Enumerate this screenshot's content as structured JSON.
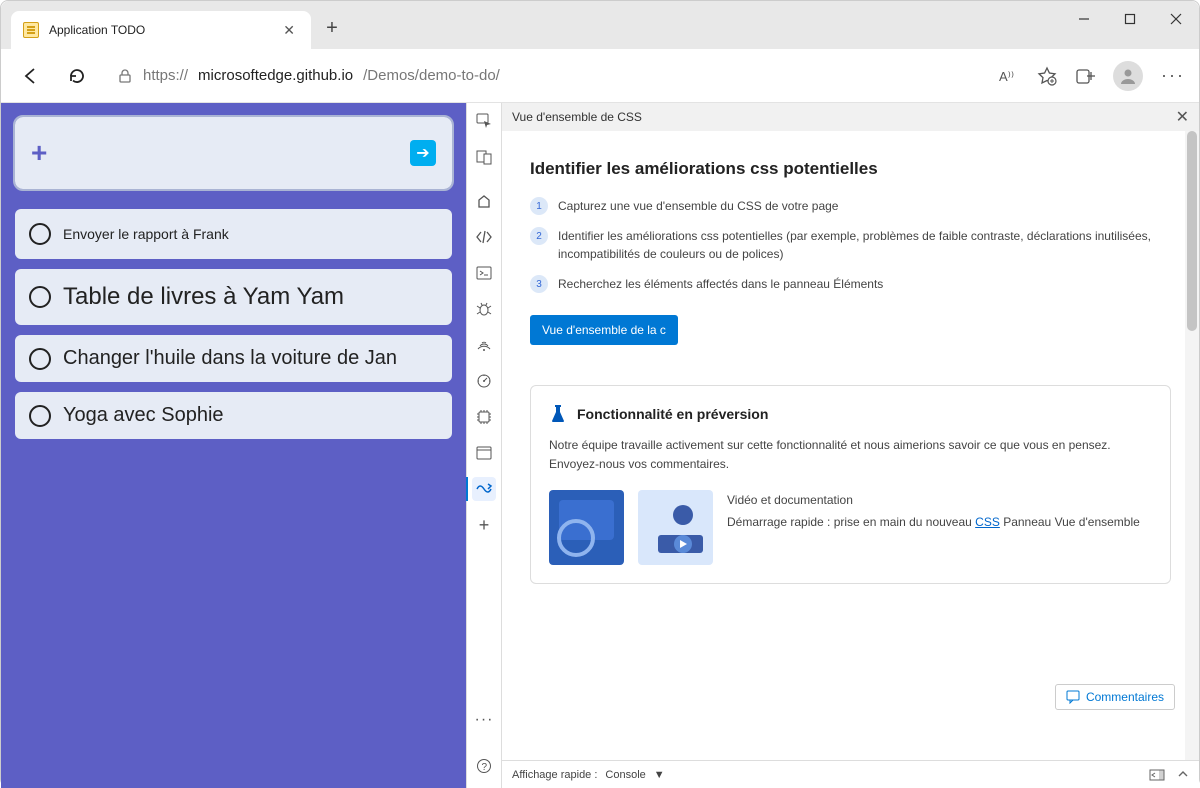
{
  "browser": {
    "tab_title": "Application TODO",
    "url_scheme": "https://",
    "url_host": "microsoftedge.github.io",
    "url_path": "/Demos/demo-to-do/"
  },
  "todo": {
    "tasks": [
      {
        "label": "Envoyer le rapport à Frank"
      },
      {
        "label": "Table de livres à Yam Yam"
      },
      {
        "label": "Changer l'huile dans la voiture de Jan"
      },
      {
        "label": "Yoga avec Sophie"
      }
    ]
  },
  "devtools": {
    "panel_title": "Vue d'ensemble de CSS",
    "heading": "Identifier les améliorations css potentielles",
    "steps": [
      "Capturez une vue d'ensemble du CSS de votre page",
      "Identifier les améliorations css potentielles (par exemple, problèmes de faible contraste, déclarations inutilisées, incompatibilités de couleurs ou de polices)",
      "Recherchez les éléments affectés dans le panneau Éléments"
    ],
    "capture_btn": "Vue d'ensemble de la c",
    "preview": {
      "title": "Fonctionnalité en préversion",
      "text": "Notre équipe travaille activement sur cette fonctionnalité et nous aimerions savoir ce que vous en pensez. Envoyez-nous vos commentaires.",
      "video_label": "Vidéo et documentation",
      "quick_prefix": "Démarrage rapide : prise en main du nouveau ",
      "quick_link": "CSS",
      "quick_suffix": " Panneau Vue d'ensemble"
    },
    "feedback": "Commentaires",
    "drawer_label": "Affichage rapide :",
    "drawer_tab": "Console"
  }
}
